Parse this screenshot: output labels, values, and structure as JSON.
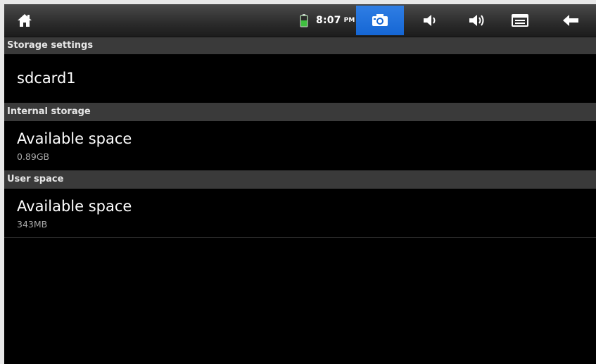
{
  "status_bar": {
    "time": "8:07",
    "ampm": "PM",
    "icons": [
      "home-icon",
      "battery-icon",
      "screenshot-icon",
      "volume-down-icon",
      "volume-up-icon",
      "menu-icon",
      "back-icon"
    ],
    "accent_color": "#1a6fdb",
    "battery_color": "#3fbf3f"
  },
  "title_bar": {
    "title": "Storage settings"
  },
  "sdcard_item": {
    "label": "sdcard1"
  },
  "internal_storage": {
    "header": "Internal storage",
    "item_title": "Available space",
    "item_value": "0.89GB"
  },
  "user_space": {
    "header": "User space",
    "item_title": "Available space",
    "item_value": "343MB"
  }
}
